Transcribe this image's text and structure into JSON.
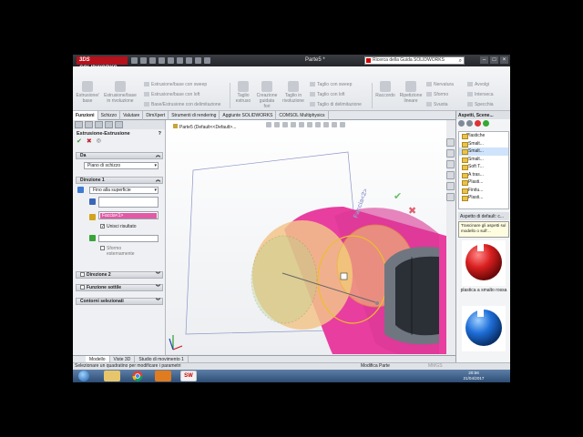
{
  "window": {
    "app_logo": "3DS SOLIDWORKS",
    "document_title": "Parte5 *",
    "help_search_placeholder": "Ricerca della Guida SOLIDWORKS",
    "buttons": [
      "minimize",
      "maximize",
      "close"
    ]
  },
  "ribbon": {
    "extrude_boss": "Estrusione/\nbase",
    "revolve_boss": "Estrusione/base\nin rivoluzione",
    "swept_boss": "Estrusione/base con sweep",
    "lofted_boss": "Estrusione/base con loft",
    "boundary_boss": "Base/Estrusione con delimitazione",
    "extruded_cut": "Taglio\nestruso",
    "hole_wizard": "Creazione\nguidata\nfori",
    "revolved_cut": "Taglio in\nrivoluzione",
    "swept_cut": "Taglio con sweep",
    "lofted_cut": "Taglio con loft",
    "boundary_cut": "Taglio di delimitazione",
    "fillet": "Raccordo",
    "linear_pattern": "Ripetizione\nlineare",
    "rib": "Nervatura",
    "draft": "Sformo",
    "shell": "Svuota",
    "wrap": "Avvolgi",
    "intersect": "Interseca",
    "mirror": "Specchia"
  },
  "tabs": [
    "Funzioni",
    "Schizzo",
    "Valutare",
    "DimXpert",
    "Strumenti di rendering",
    "Aggiunte SOLIDWORKS",
    "COMSOL Multiphysics"
  ],
  "active_tab": "Funzioni",
  "property_manager": {
    "title": "Estrusione-Estrusione",
    "help": "?",
    "da_label": "Da",
    "da_value": "Piano di schizzo",
    "direction1_label": "Direzione 1",
    "end_condition": "Fino alla superficie",
    "selected_face": "Faccia<1>",
    "merge_result": "Unisci risultato",
    "draft_outward": "Sformo\nesternamente",
    "direction2_label": "Direzione 2",
    "thin_feature_label": "Funzione sottile",
    "selected_contours_label": "Contorni selezionati"
  },
  "viewport": {
    "tree_flyout": "Parte5 (Default<<Default>...",
    "face_tag": "Faccia<2>",
    "triad": "triad",
    "confirm_ok": "✔",
    "confirm_cancel": "✖",
    "colors": {
      "pink": "#e83ea0",
      "yellow_face": "#f2d26e",
      "slot_dark": "#2b2f36",
      "green_circle": "#b5d48a"
    }
  },
  "task_pane": {
    "title": "Aspetti, Scene...",
    "tree": [
      "Plastiche",
      "Smalt...",
      "Smalt...",
      "Smalt...",
      "Soft T...",
      "A tras...",
      "Plasti...",
      "Finitu...",
      "Plasti..."
    ],
    "selected_index": 2,
    "section_title": "Aspetto di default: c...",
    "tooltip": "Trascinare gli aspetti sul modello o sull'...",
    "material1_caption": "plastica a smalto rossa",
    "material2_caption": ""
  },
  "bottom_tabs": [
    "Modello",
    "Viste 3D",
    "Studio di movimento 1"
  ],
  "active_bottom_tab": "Modello",
  "status": {
    "message": "Selezionare un quadratino per modificare i parametri",
    "mode": "Modifica Parte",
    "units": "MMGS"
  },
  "taskbar": {
    "time": "20:56",
    "date": "21/04/2017",
    "apps": [
      "explorer",
      "chrome",
      "media",
      "solidworks"
    ]
  }
}
